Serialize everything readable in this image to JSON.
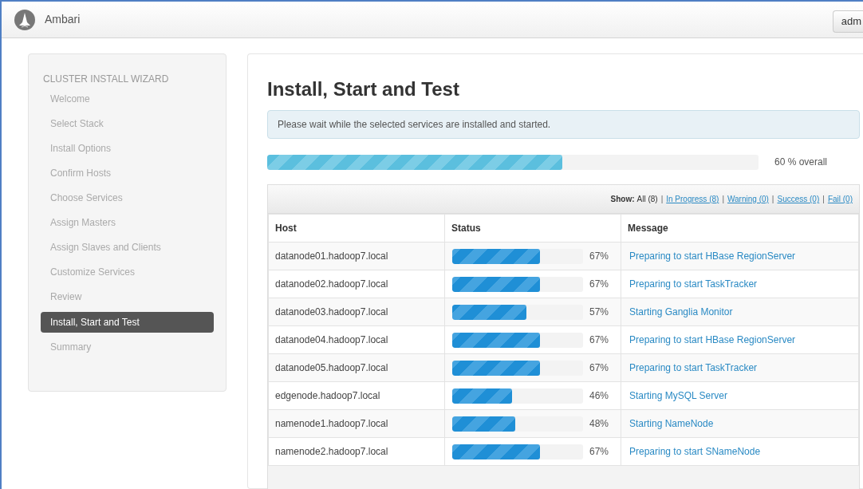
{
  "header": {
    "brand": "Ambari",
    "user_button": "adm"
  },
  "sidebar": {
    "title": "CLUSTER INSTALL WIZARD",
    "items": [
      {
        "label": "Welcome",
        "selected": false
      },
      {
        "label": "Select Stack",
        "selected": false
      },
      {
        "label": "Install Options",
        "selected": false
      },
      {
        "label": "Confirm Hosts",
        "selected": false
      },
      {
        "label": "Choose Services",
        "selected": false
      },
      {
        "label": "Assign Masters",
        "selected": false
      },
      {
        "label": "Assign Slaves and Clients",
        "selected": false
      },
      {
        "label": "Customize Services",
        "selected": false
      },
      {
        "label": "Review",
        "selected": false
      },
      {
        "label": "Install, Start and Test",
        "selected": true
      },
      {
        "label": "Summary",
        "selected": false
      }
    ]
  },
  "main": {
    "title": "Install, Start and Test",
    "alert": "Please wait while the selected services are installed and started.",
    "overall": {
      "level": 0.6,
      "reading": "60 % overall"
    },
    "filter": {
      "label": "Show:",
      "separator": "|",
      "options": [
        {
          "label": "All (8)",
          "selected": true
        },
        {
          "label": "In Progress (8)",
          "selected": false
        },
        {
          "label": "Warning (0)",
          "selected": false
        },
        {
          "label": "Success (0)",
          "selected": false
        },
        {
          "label": "Fail (0)",
          "selected": false
        }
      ]
    },
    "table": {
      "columns": [
        "Host",
        "Status",
        "Message"
      ],
      "rows": [
        {
          "host": "datanode01.hadoop7.local",
          "level": 0.67,
          "reading": "67%",
          "message": "Preparing to start HBase RegionServer"
        },
        {
          "host": "datanode02.hadoop7.local",
          "level": 0.67,
          "reading": "67%",
          "message": "Preparing to start TaskTracker"
        },
        {
          "host": "datanode03.hadoop7.local",
          "level": 0.57,
          "reading": "57%",
          "message": "Starting Ganglia Monitor"
        },
        {
          "host": "datanode04.hadoop7.local",
          "level": 0.67,
          "reading": "67%",
          "message": "Preparing to start HBase RegionServer"
        },
        {
          "host": "datanode05.hadoop7.local",
          "level": 0.67,
          "reading": "67%",
          "message": "Preparing to start TaskTracker"
        },
        {
          "host": "edgenode.hadoop7.local",
          "level": 0.46,
          "reading": "46%",
          "message": "Starting MySQL Server"
        },
        {
          "host": "namenode1.hadoop7.local",
          "level": 0.48,
          "reading": "48%",
          "message": "Starting NameNode"
        },
        {
          "host": "namenode2.hadoop7.local",
          "level": 0.67,
          "reading": "67%",
          "message": "Preparing to start SNameNode"
        }
      ]
    }
  }
}
